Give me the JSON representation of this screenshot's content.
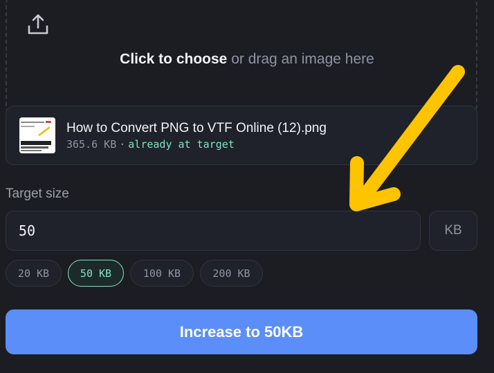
{
  "dropzone": {
    "icon": "upload-icon",
    "strong_text": "Click to choose",
    "rest_text": " or drag an image here"
  },
  "file": {
    "name": "How to Convert PNG to VTF Online (12).png",
    "size": "365.6 KB",
    "separator": "·",
    "status": "already at target"
  },
  "target": {
    "label": "Target size",
    "value": "50",
    "unit": "KB"
  },
  "presets": [
    {
      "label": "20 KB",
      "active": false
    },
    {
      "label": "50 KB",
      "active": true
    },
    {
      "label": "100 KB",
      "active": false
    },
    {
      "label": "200 KB",
      "active": false
    }
  ],
  "cta": {
    "label": "Increase to 50KB"
  },
  "colors": {
    "background": "#1b1d23",
    "accent_blue": "#5b8ef9",
    "accent_green": "#7fe3c0",
    "annotation_arrow": "#ffc400"
  }
}
